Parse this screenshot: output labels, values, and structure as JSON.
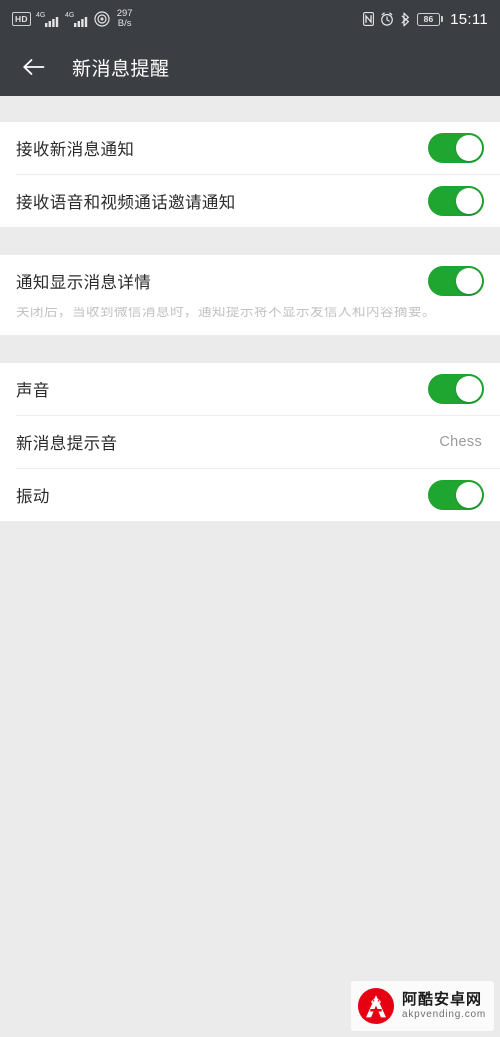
{
  "statusbar": {
    "hd_label": "HD",
    "sim1_network": "4G",
    "sim2_network": "4G",
    "hotspot_icon": "wifi-radar-icon",
    "nfc_icon": "nfc-icon",
    "alarm_icon": "alarm-clock-icon",
    "bluetooth_icon": "bluetooth-icon",
    "net_speed_value": "297",
    "net_speed_unit": "B/s",
    "battery_level": "86",
    "clock": "15:11"
  },
  "header": {
    "back_icon": "back-arrow-icon",
    "title": "新消息提醒"
  },
  "colors": {
    "statusbar_bg": "#3b3e43",
    "header_bg": "#3b3e43",
    "page_bg": "#ebebeb",
    "row_bg": "#ffffff",
    "toggle_on": "#1fa630",
    "toggle_off": "#d9d9d9",
    "label_text": "#2b2b2b",
    "desc_text": "#c2c2c2",
    "value_text": "#9a9a9a",
    "watermark_red": "#e60012"
  },
  "groups": [
    {
      "id": "notifications",
      "rows": [
        {
          "id": "receive-new-message-notification",
          "label": "接收新消息通知",
          "control": "toggle",
          "state": "on",
          "state_label": "开"
        },
        {
          "id": "receive-voice-video-call-invite-notification",
          "label": "接收语音和视频通话邀请通知",
          "control": "toggle",
          "state": "on",
          "state_label": "开"
        }
      ]
    },
    {
      "id": "message-detail",
      "rows": [
        {
          "id": "show-message-detail-in-notification",
          "label": "通知显示消息详情",
          "control": "toggle",
          "state": "on",
          "state_label": "开",
          "description": "关闭后，当收到微信消息时，通知提示将不显示发信人和内容摘要。"
        }
      ]
    },
    {
      "id": "sound-vibration",
      "rows": [
        {
          "id": "sound",
          "label": "声音",
          "control": "toggle",
          "state": "on",
          "state_label": "开"
        },
        {
          "id": "new-message-tone",
          "label": "新消息提示音",
          "control": "value",
          "value": "Chess"
        },
        {
          "id": "vibration",
          "label": "振动",
          "control": "toggle",
          "state": "on",
          "state_label": "开"
        }
      ]
    }
  ],
  "watermark": {
    "logo_icon": "android-a-logo-icon",
    "site_name_cn": "阿酷安卓网",
    "site_url": "akpvending.com"
  }
}
